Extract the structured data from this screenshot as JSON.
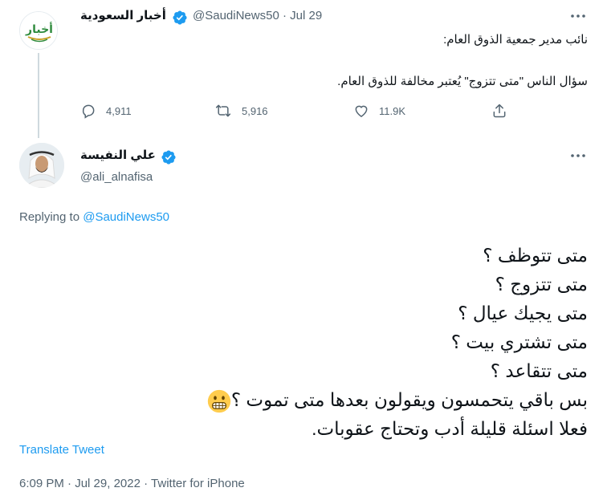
{
  "parent_tweet": {
    "author_name": "أخبار السعودية",
    "handle": "@SaudiNews50",
    "separator": "·",
    "date": "Jul 29",
    "avatar_logo_text": "أخبار",
    "text_line1": "نائب مدير جمعية الذوق العام:",
    "text_line2": "سؤال الناس \"متى تتزوج\" يُعتبر مخالفة للذوق العام.",
    "stats": {
      "replies": "4,911",
      "retweets": "5,916",
      "likes": "11.9K"
    }
  },
  "main_tweet": {
    "author_name": "علي النفيسة",
    "handle": "@ali_alnafisa",
    "replying_prefix": "Replying to",
    "replying_to": "@SaudiNews50",
    "lines": [
      "متى تتوظف ؟",
      "متى تتزوج ؟",
      "متى يجيك عيال ؟",
      "متى تشتري بيت ؟",
      "متى تتقاعد ؟",
      "بس باقي يتحمسون ويقولون بعدها متى تموت ؟",
      "فعلا اسئلة قليلة أدب وتحتاج عقوبات."
    ],
    "translate_label": "Translate Tweet",
    "time": "6:09 PM",
    "separator": "·",
    "date": "Jul 29, 2022",
    "source": "Twitter for iPhone"
  },
  "colors": {
    "accent": "#1d9bf0",
    "muted": "#536471",
    "text": "#0f1419",
    "thread_line": "#cfd9de",
    "logo_green": "#2e8b3d",
    "logo_gold": "#c9a227"
  }
}
